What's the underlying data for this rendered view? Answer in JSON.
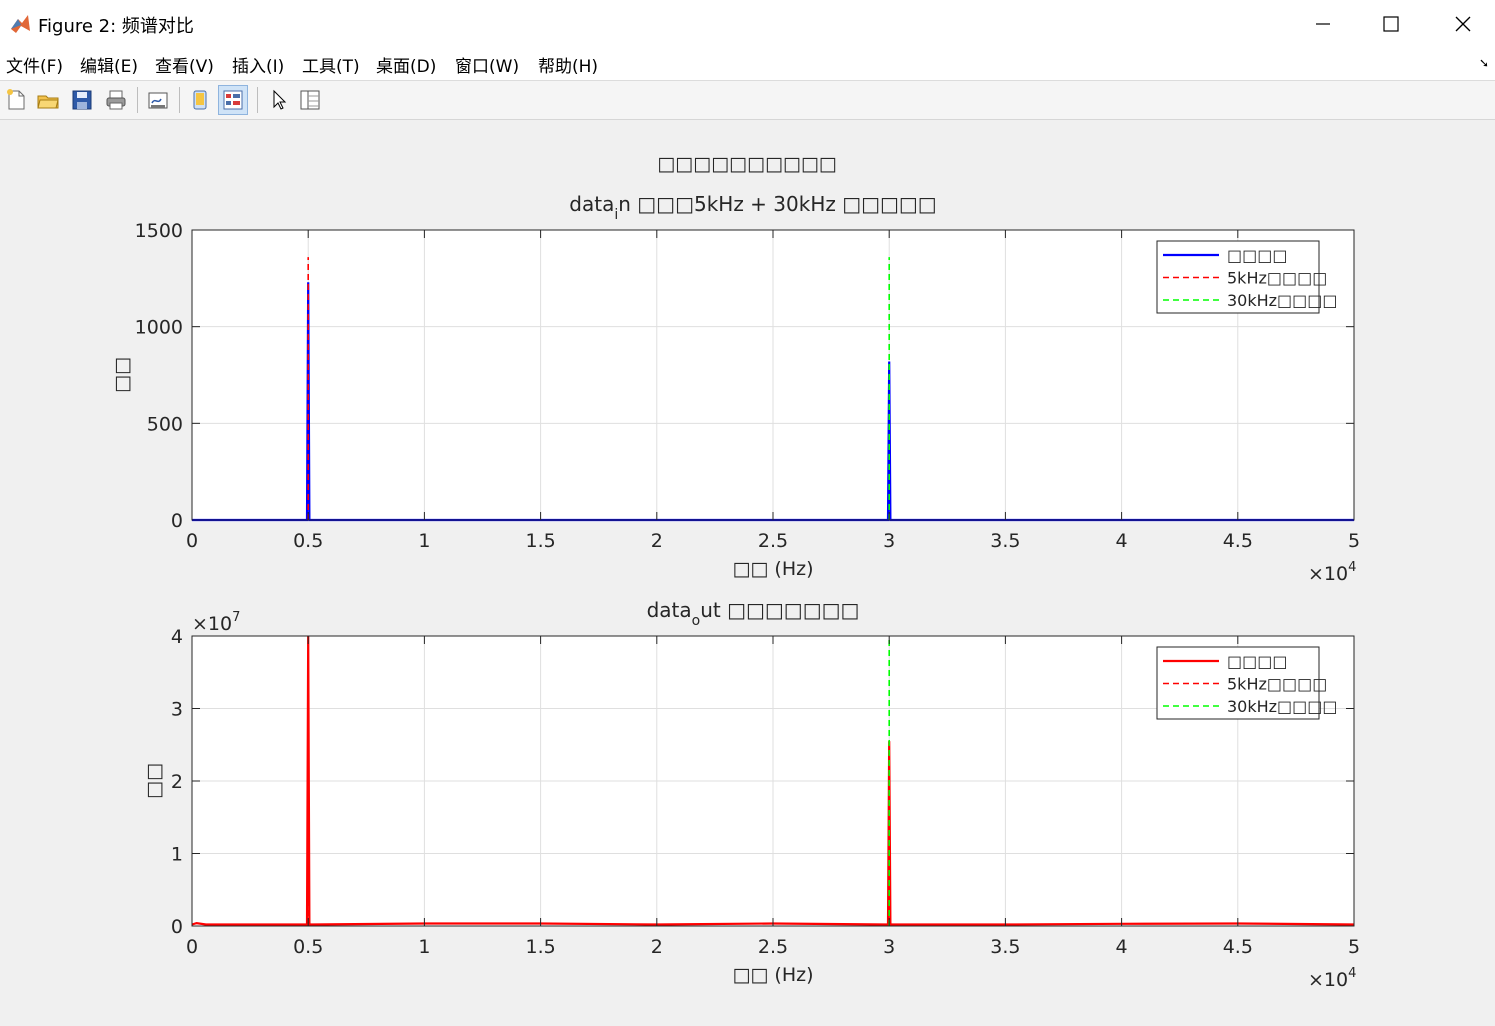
{
  "window": {
    "title": "Figure 2: 频谱对比",
    "controls": [
      "minimize",
      "maximize",
      "close"
    ]
  },
  "menu": {
    "items": [
      "文件(F)",
      "编辑(E)",
      "查看(V)",
      "插入(I)",
      "工具(T)",
      "桌面(D)",
      "窗口(W)",
      "帮助(H)"
    ]
  },
  "toolbar": {
    "buttons": [
      "new-figure-icon",
      "open-file-icon",
      "save-icon",
      "print-icon",
      "link-plot-icon",
      "hide-plot-tools-icon",
      "show-plot-tools-icon",
      "edit-plot-icon",
      "open-property-inspector-icon"
    ]
  },
  "figure": {
    "sgtitle": "□□□□□□□□□□"
  },
  "chart_data": [
    {
      "type": "line",
      "title": "data_in □□□5kHz + 30kHz □□□□□",
      "title_base": "data",
      "title_sub": "i",
      "title_rest": "n □□□5kHz + 30kHz □□□□□",
      "xlabel": "□□ (Hz)",
      "ylabel": "□□",
      "xlim": [
        0,
        50000
      ],
      "ylim": [
        0,
        1500
      ],
      "xticks": [
        0,
        5000,
        10000,
        15000,
        20000,
        25000,
        30000,
        35000,
        40000,
        45000,
        50000
      ],
      "xtick_labels": [
        "0",
        "0.5",
        "1",
        "1.5",
        "2",
        "2.5",
        "3",
        "3.5",
        "4",
        "4.5",
        "5"
      ],
      "yticks": [
        0,
        500,
        1000,
        1500
      ],
      "ytick_labels": [
        "0",
        "500",
        "1000",
        "1500"
      ],
      "x_exponent": "4",
      "y_exponent": "",
      "grid": true,
      "legend_position": "top-right",
      "series": [
        {
          "name": "□□□□",
          "color": "#0000ff",
          "style": "solid",
          "x": [
            0,
            4800,
            4950,
            5000,
            5050,
            5200,
            29800,
            29950,
            30000,
            30050,
            30200,
            50000
          ],
          "y": [
            0,
            0,
            0,
            1230,
            0,
            0,
            0,
            0,
            820,
            0,
            0,
            0
          ]
        },
        {
          "name": "5kHz□□□□",
          "color": "#ff0000",
          "style": "dashed",
          "x": [
            5000,
            5000
          ],
          "y": [
            0,
            1360
          ]
        },
        {
          "name": "30kHz□□□□",
          "color": "#00ff00",
          "style": "dashed",
          "x": [
            30000,
            30000
          ],
          "y": [
            0,
            1360
          ]
        }
      ]
    },
    {
      "type": "line",
      "title": "data_out □□□□□□□",
      "title_base": "data",
      "title_sub": "o",
      "title_rest": "ut □□□□□□□",
      "xlabel": "□□ (Hz)",
      "ylabel": "□□",
      "xlim": [
        0,
        50000
      ],
      "ylim": [
        0,
        40000000
      ],
      "xticks": [
        0,
        5000,
        10000,
        15000,
        20000,
        25000,
        30000,
        35000,
        40000,
        45000,
        50000
      ],
      "xtick_labels": [
        "0",
        "0.5",
        "1",
        "1.5",
        "2",
        "2.5",
        "3",
        "3.5",
        "4",
        "4.5",
        "5"
      ],
      "yticks": [
        0,
        10000000,
        20000000,
        30000000,
        40000000
      ],
      "ytick_labels": [
        "0",
        "1",
        "2",
        "3",
        "4"
      ],
      "x_exponent": "4",
      "y_exponent": "7",
      "grid": true,
      "legend_position": "top-right",
      "series": [
        {
          "name": "□□□□",
          "color": "#ff0000",
          "style": "solid",
          "x": [
            0,
            200,
            600,
            4800,
            4950,
            5000,
            5050,
            5200,
            10000,
            15000,
            20000,
            25000,
            29800,
            29950,
            30000,
            30050,
            30200,
            35000,
            40000,
            45000,
            50000
          ],
          "y": [
            200000,
            400000,
            200000,
            200000,
            200000,
            40000000,
            200000,
            200000,
            350000,
            350000,
            200000,
            350000,
            200000,
            200000,
            25500000,
            200000,
            200000,
            200000,
            300000,
            350000,
            200000
          ]
        },
        {
          "name": "5kHz□□□□",
          "color": "#ff0000",
          "style": "dashed",
          "x": [
            5000,
            5000
          ],
          "y": [
            0,
            40000000
          ]
        },
        {
          "name": "30kHz□□□□",
          "color": "#00ff00",
          "style": "dashed",
          "x": [
            30000,
            30000
          ],
          "y": [
            0,
            40000000
          ]
        }
      ]
    }
  ]
}
